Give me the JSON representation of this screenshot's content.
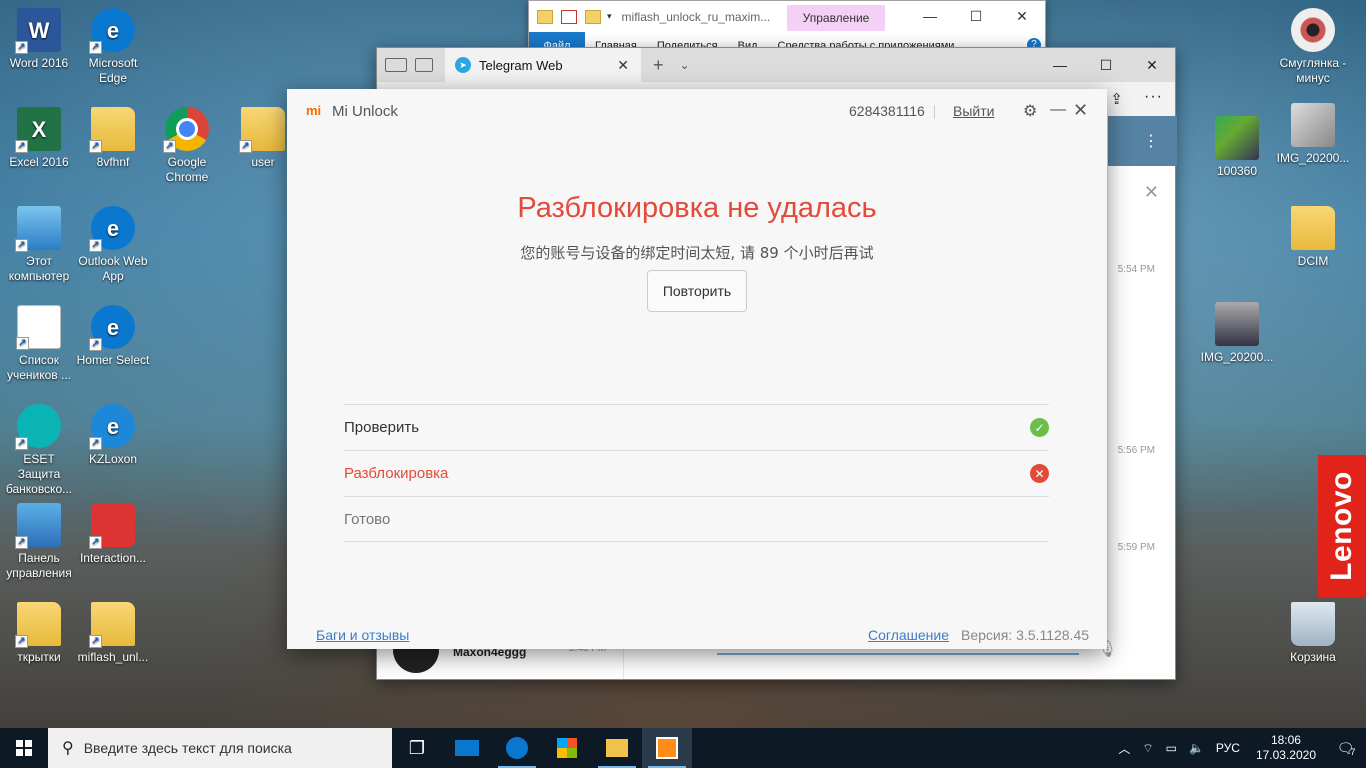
{
  "desktop": {
    "icons_left": [
      {
        "label": "Word 2016",
        "icon": "word-icon",
        "glyph": "W"
      },
      {
        "label": "Microsoft Edge",
        "icon": "edge-icon",
        "glyph": "e"
      },
      {
        "label": "Excel 2016",
        "icon": "excel-icon",
        "glyph": "X"
      },
      {
        "label": "8vfhnf",
        "icon": "folder-icon",
        "glyph": ""
      },
      {
        "label": "Google Chrome",
        "icon": "chrome-icon",
        "glyph": ""
      },
      {
        "label": "user",
        "icon": "user-folder-icon",
        "glyph": ""
      },
      {
        "label": "Этот компьютер",
        "icon": "computer-icon",
        "glyph": ""
      },
      {
        "label": "Outlook Web App",
        "icon": "edge-icon",
        "glyph": "e"
      },
      {
        "label": "Список учеников ...",
        "icon": "document-icon",
        "glyph": ""
      },
      {
        "label": "Homer Select",
        "icon": "edge-icon",
        "glyph": "e"
      },
      {
        "label": "ESET Защита банковско...",
        "icon": "eset-icon",
        "glyph": ""
      },
      {
        "label": "KZLoxon",
        "icon": "ie-icon",
        "glyph": "e"
      },
      {
        "label": "Панель управления",
        "icon": "control-panel-icon",
        "glyph": ""
      },
      {
        "label": "Interaction...",
        "icon": "headset-icon",
        "glyph": ""
      },
      {
        "label": "ткрытки",
        "icon": "folder-icon",
        "glyph": ""
      },
      {
        "label": "miflash_unl...",
        "icon": "folder-icon",
        "glyph": ""
      }
    ],
    "icons_right": [
      {
        "label": "Смуглянка - минус",
        "icon": "audio-disc-icon"
      },
      {
        "label": "100360",
        "icon": "image-icon"
      },
      {
        "label": "IMG_20200...",
        "icon": "image-icon"
      },
      {
        "label": "DCIM",
        "icon": "folder-icon"
      },
      {
        "label": "IMG_20200...",
        "icon": "image-icon"
      },
      {
        "label": "Корзина",
        "icon": "recycle-bin-icon"
      }
    ],
    "brand_badge": "Lenovo"
  },
  "explorer": {
    "title": "miflash_unlock_ru_maxim...",
    "manage_tab": "Управление",
    "ribbon_tabs": [
      "Файл",
      "Главная",
      "Поделиться",
      "Вид",
      "Средства работы с приложениями"
    ],
    "help": "?",
    "controls": {
      "minimize": "—",
      "maximize": "☐",
      "close": "✕"
    }
  },
  "edge": {
    "tab_title": "Telegram Web",
    "tab_close": "✕",
    "new_tab": "+",
    "tabs_down": "⌄",
    "controls": {
      "minimize": "—",
      "maximize": "☐",
      "close": "✕"
    },
    "more": "···",
    "telegram": {
      "times": [
        "5:54 PM",
        "5:56 PM",
        "5:59 PM"
      ],
      "contact_name": "Maxon4eggg",
      "contact_time": "5:43 PM"
    }
  },
  "mi_unlock": {
    "app_name": "Mi Unlock",
    "logo": "mi",
    "account_id": "6284381116",
    "logout": "Выйти",
    "status_title": "Разблокировка не удалась",
    "status_message": "您的账号与设备的绑定时间太短, 请 89 个小时后再试",
    "retry_button": "Повторить",
    "steps": [
      {
        "label": "Проверить",
        "state": "done",
        "color": "#333333"
      },
      {
        "label": "Разблокировка",
        "state": "failed",
        "color": "#e34a3a"
      },
      {
        "label": "Готово",
        "state": "pending",
        "color": "#777777"
      }
    ],
    "bugs_link": "Баги и отзывы",
    "agreement_link": "Соглашение",
    "version": "Версия: 3.5.1128.45"
  },
  "taskbar": {
    "search_placeholder": "Введите здесь текст для поиска",
    "language": "РУС",
    "time": "18:06",
    "date": "17.03.2020",
    "notification_count": "7"
  }
}
